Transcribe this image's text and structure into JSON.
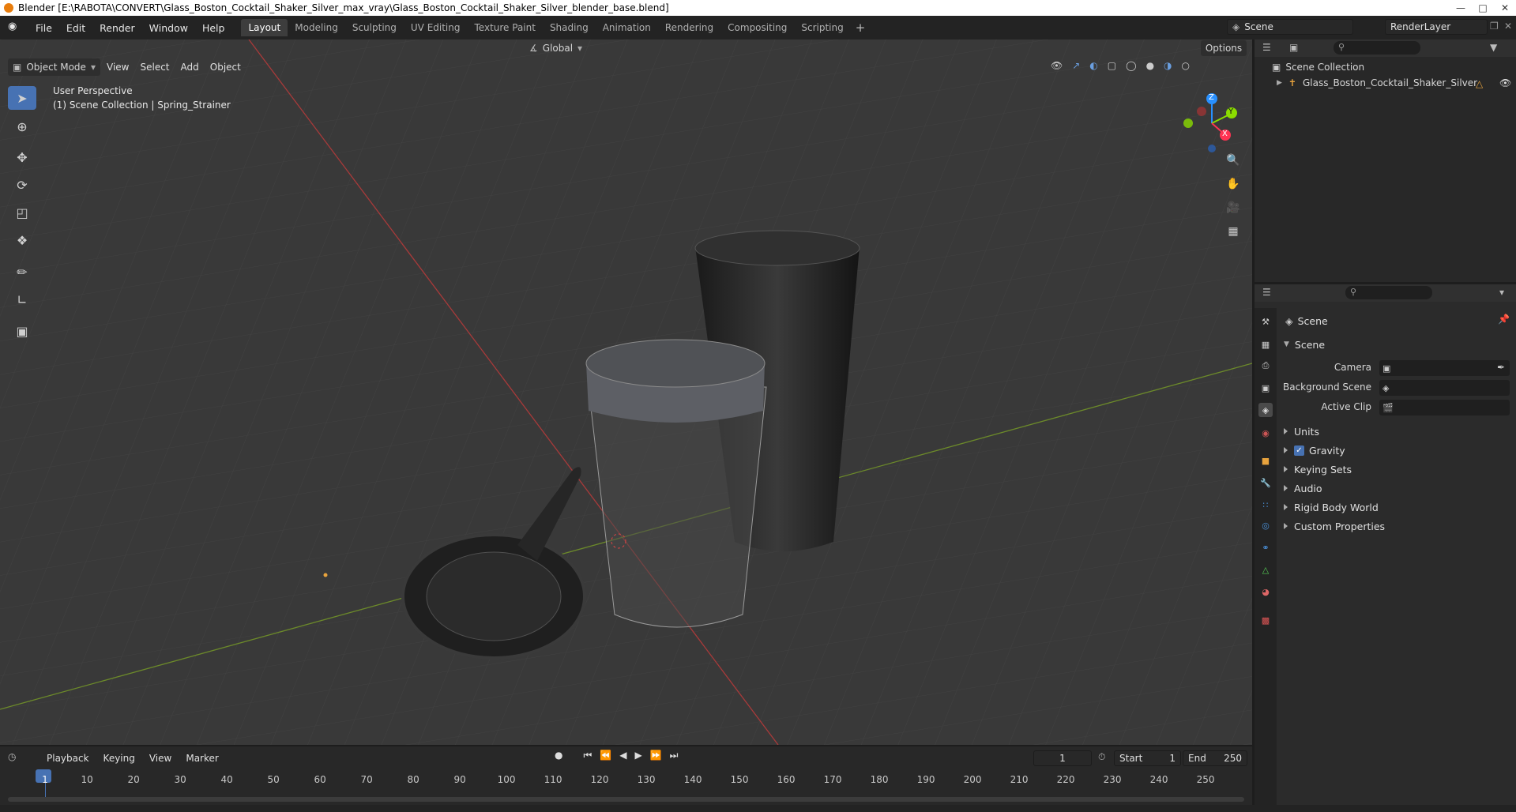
{
  "titlebar": {
    "text": "Blender [E:\\RABOTA\\CONVERT\\Glass_Boston_Cocktail_Shaker_Silver_max_vray\\Glass_Boston_Cocktail_Shaker_Silver_blender_base.blend]"
  },
  "menu": [
    "File",
    "Edit",
    "Render",
    "Window",
    "Help"
  ],
  "workspaces": [
    "Layout",
    "Modeling",
    "Sculpting",
    "UV Editing",
    "Texture Paint",
    "Shading",
    "Animation",
    "Rendering",
    "Compositing",
    "Scripting"
  ],
  "scene_field": "Scene",
  "renderlayer_field": "RenderLayer",
  "viewport": {
    "mode": "Object Mode",
    "menus": [
      "View",
      "Select",
      "Add",
      "Object"
    ],
    "transform": "Global",
    "options": "Options",
    "overlay_line1": "User Perspective",
    "overlay_line2": "(1) Scene Collection | Spring_Strainer",
    "axis_x": "X",
    "axis_y": "Y",
    "axis_z": "Z"
  },
  "outliner": {
    "collection": "Scene Collection",
    "object": "Glass_Boston_Cocktail_Shaker_Silver"
  },
  "properties": {
    "header": "Scene",
    "panel": "Scene",
    "camera_label": "Camera",
    "bg_label": "Background Scene",
    "clip_label": "Active Clip",
    "sections": [
      "Units",
      "Gravity",
      "Keying Sets",
      "Audio",
      "Rigid Body World",
      "Custom Properties"
    ],
    "gravity_checked": true
  },
  "timeline": {
    "menus": [
      "Playback",
      "Keying",
      "View",
      "Marker"
    ],
    "current_frame": "1",
    "start_label": "Start",
    "start": "1",
    "end_label": "End",
    "end": "250",
    "ticks": [
      "1",
      "10",
      "20",
      "30",
      "40",
      "50",
      "60",
      "70",
      "80",
      "90",
      "100",
      "110",
      "120",
      "130",
      "140",
      "150",
      "160",
      "170",
      "180",
      "190",
      "200",
      "210",
      "220",
      "230",
      "240",
      "250"
    ]
  },
  "colors": {
    "accent": "#4772b3",
    "x_axis": "#ff3352",
    "y_axis": "#8bdc00",
    "z_axis": "#2890ff",
    "orange": "#e87d0d"
  }
}
